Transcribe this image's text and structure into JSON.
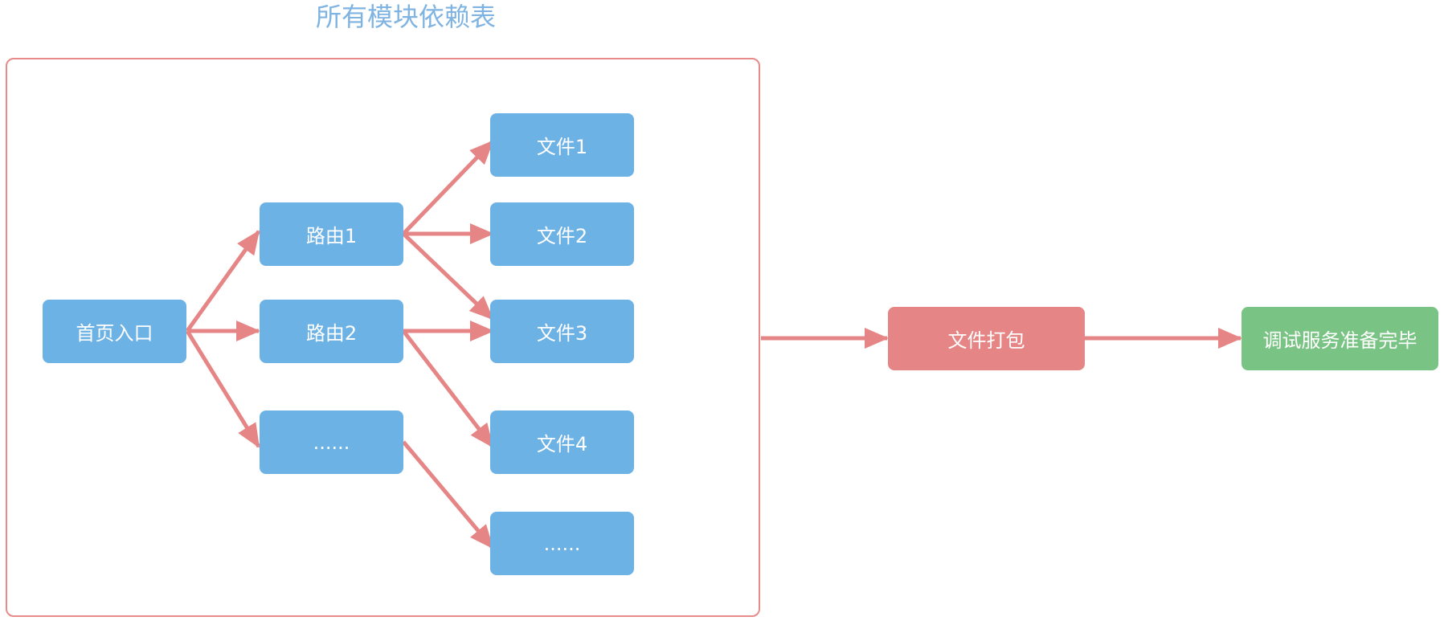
{
  "title": "所有模块依赖表",
  "nodes": {
    "entry": "首页入口",
    "route1": "路由1",
    "route2": "路由2",
    "route_more": "......",
    "file1": "文件1",
    "file2": "文件2",
    "file3": "文件3",
    "file4": "文件4",
    "file_more": "......",
    "bundle": "文件打包",
    "ready": "调试服务准备完毕"
  },
  "colors": {
    "module_node": "#6db2e5",
    "bundle_node": "#e68585",
    "ready_node": "#79c484",
    "arrow": "#e68585",
    "frame": "#e68a8a",
    "title": "#7fb3e1"
  }
}
